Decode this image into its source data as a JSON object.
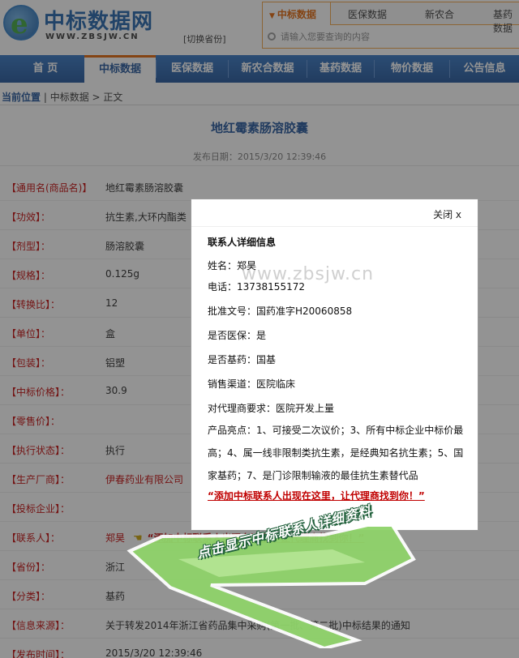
{
  "header": {
    "site_name": "中标数据网",
    "site_url": "WWW.ZBSJW.CN",
    "switch_province": "[切换省份]",
    "search_tabs": [
      "中标数据",
      "医保数据",
      "新农合",
      "基药数据"
    ],
    "search_placeholder": "请输入您要查询的内容"
  },
  "nav": {
    "items": [
      "首 页",
      "中标数据",
      "医保数据",
      "新农合数据",
      "基药数据",
      "物价数据",
      "公告信息"
    ]
  },
  "breadcrumb": {
    "current_label": "当前位置",
    "sep": " | ",
    "path": "中标数据 > 正文"
  },
  "article": {
    "title": "地红霉素肠溶胶囊",
    "date": "发布日期：2015/3/20 12:39:46"
  },
  "detail_rows": [
    {
      "key": "【通用名(商品名)】",
      "value": "地红霉素肠溶胶囊"
    },
    {
      "key": "【功效】：",
      "value": "抗生素,大环内酯类"
    },
    {
      "key": "【剂型】：",
      "value": "肠溶胶囊"
    },
    {
      "key": "【规格】：",
      "value": "0.125g"
    },
    {
      "key": "【转换比】：",
      "value": "12"
    },
    {
      "key": "【单位】：",
      "value": "盒"
    },
    {
      "key": "【包装】：",
      "value": "铝塑"
    },
    {
      "key": "【中标价格】：",
      "value": "30.9"
    },
    {
      "key": "【零售价】：",
      "value": ""
    },
    {
      "key": "【执行状态】：",
      "value": "执行"
    },
    {
      "key": "【生产厂商】：",
      "value": "伊春药业有限公司"
    },
    {
      "key": "【投标企业】：",
      "value": ""
    },
    {
      "key": "【联系人】：",
      "value": "郑昊",
      "promo": "“添加中标联系人出现在这里，让代理商找到你！”"
    },
    {
      "key": "【省份】：",
      "value": "浙江"
    },
    {
      "key": "【分类】：",
      "value": "基药"
    },
    {
      "key": "【信息来源】：",
      "value": "关于转发2014年浙江省药品集中采购(第一批、第二批)中标结果的通知"
    },
    {
      "key": "【发布时间】：",
      "value": "2015/3/20 12:39:46"
    }
  ],
  "modal": {
    "close": "关闭 x",
    "heading": "联系人详细信息",
    "name": "姓名：郑昊",
    "phone": "电话：13738155172",
    "approval": "批准文号：国药准字H20060858",
    "medical_insurance": "是否医保：是",
    "essential_drug": "是否基药：国基",
    "channel": "销售渠道：医院临床",
    "agent_req": "对代理商要求：医院开发上量",
    "highlights": "产品亮点：1、可接受二次议价；3、所有中标企业中标价最高；4、属一线非限制类抗生素，是经典知名抗生素；5、国家基药；7、是门诊限制输液的最佳抗生素替代品",
    "cta": "“添加中标联系人出现在这里，让代理商找到你！”",
    "watermark": "www.zbsjw.cn"
  },
  "callout": {
    "text": "点击显示中标联系人详细资料"
  }
}
